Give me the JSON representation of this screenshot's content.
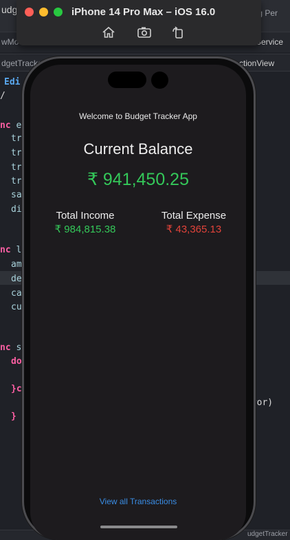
{
  "simulator": {
    "title": "iPhone 14 Pro Max – iOS 16.0",
    "buttons": [
      {
        "name": "home-icon"
      },
      {
        "name": "screenshot-icon"
      },
      {
        "name": "rotate-icon"
      }
    ]
  },
  "xcode": {
    "tabs": [
      "udg",
      "ing Per"
    ],
    "row2": [
      "wMo",
      "Service"
    ],
    "breadcrumb_left": "dgetTracke",
    "breadcrumb_right": "ctionView",
    "edit_label": "Edi",
    "code_fragments": [
      {
        "kw": "nc",
        "id": "e"
      },
      {
        "kw": "",
        "id": "tr"
      },
      {
        "kw": "",
        "id": "tr"
      },
      {
        "kw": "",
        "id": "tr"
      },
      {
        "kw": "",
        "id": "tr"
      },
      {
        "kw": "",
        "id": "sa"
      },
      {
        "kw": "",
        "id": "di"
      },
      {
        "kw": "nc",
        "id": "l"
      },
      {
        "kw": "",
        "id": "am"
      },
      {
        "kw": "",
        "id": "de"
      },
      {
        "kw": "",
        "id": "ca"
      },
      {
        "kw": "",
        "id": "cu"
      },
      {
        "kw": "nc",
        "id": "s"
      },
      {
        "kw": "do",
        "id": ""
      },
      {
        "kw": "}c",
        "id": ""
      },
      {
        "kw": "}",
        "id": ""
      }
    ],
    "error_fragment": "rror)",
    "bottom_fragment": "udgetTracker"
  },
  "app": {
    "welcome_text": "Welcome to Budget Tracker App",
    "balance_label": "Current Balance",
    "balance_amount": "₹ 941,450.25",
    "income_label": "Total Income",
    "income_amount": "₹ 984,815.38",
    "expense_label": "Total Expense",
    "expense_amount": "₹ 43,365.13",
    "view_all_link": "View all Transactions"
  },
  "colors": {
    "positive": "#34c759",
    "negative": "#e1433a",
    "link": "#3a8ee6",
    "screen_bg": "#1d1b1e"
  }
}
